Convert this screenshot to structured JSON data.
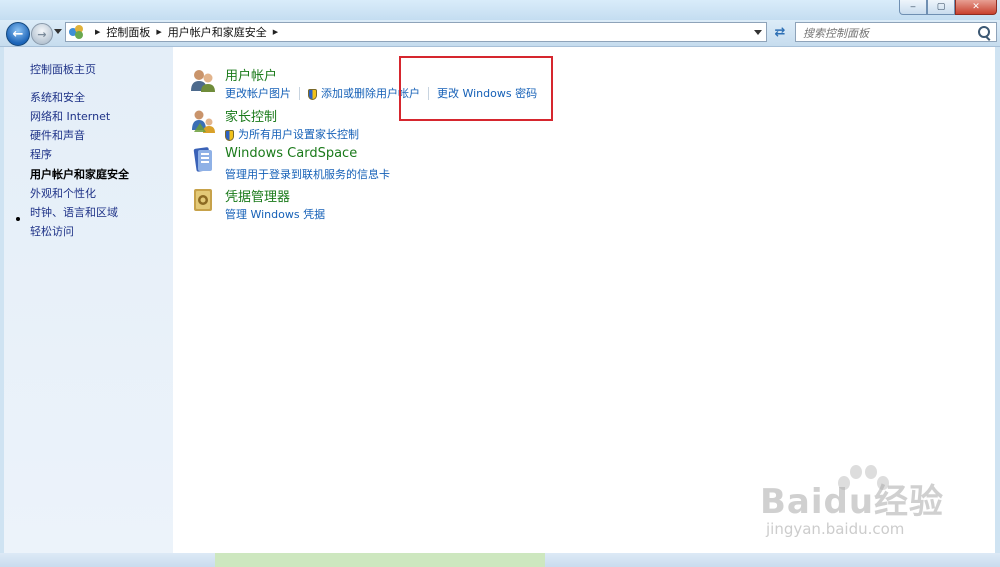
{
  "window": {
    "controls": [
      "minimize",
      "maximize",
      "close"
    ]
  },
  "addressbar": {
    "crumbs": [
      "控制面板",
      "用户帐户和家庭安全"
    ]
  },
  "search": {
    "placeholder": "搜索控制面板"
  },
  "sidebar": {
    "items": [
      {
        "label": "控制面板主页"
      },
      {
        "label": "系统和安全"
      },
      {
        "label": "网络和 Internet"
      },
      {
        "label": "硬件和声音"
      },
      {
        "label": "程序"
      },
      {
        "label": "用户帐户和家庭安全",
        "current": true
      },
      {
        "label": "外观和个性化"
      },
      {
        "label": "时钟、语言和区域"
      },
      {
        "label": "轻松访问"
      }
    ]
  },
  "categories": [
    {
      "title": "用户帐户",
      "icon": "user-accounts-icon",
      "links": [
        "更改帐户图片",
        "添加或删除用户帐户",
        "更改 Windows 密码"
      ]
    },
    {
      "title": "家长控制",
      "icon": "parental-controls-icon",
      "links": [
        "为所有用户设置家长控制"
      ]
    },
    {
      "title": "Windows CardSpace",
      "icon": "cardspace-icon",
      "links": [
        "管理用于登录到联机服务的信息卡"
      ]
    },
    {
      "title": "凭据管理器",
      "icon": "credential-manager-icon",
      "links": [
        "管理 Windows 凭据"
      ]
    }
  ],
  "annotation": {
    "color": "#d6262e"
  },
  "watermark": {
    "brand": "Baidu经验",
    "url": "jingyan.baidu.com"
  },
  "colors": {
    "link": "#1560b7",
    "category_title": "#1a7a1a",
    "sidebar_link": "#1e3287"
  }
}
